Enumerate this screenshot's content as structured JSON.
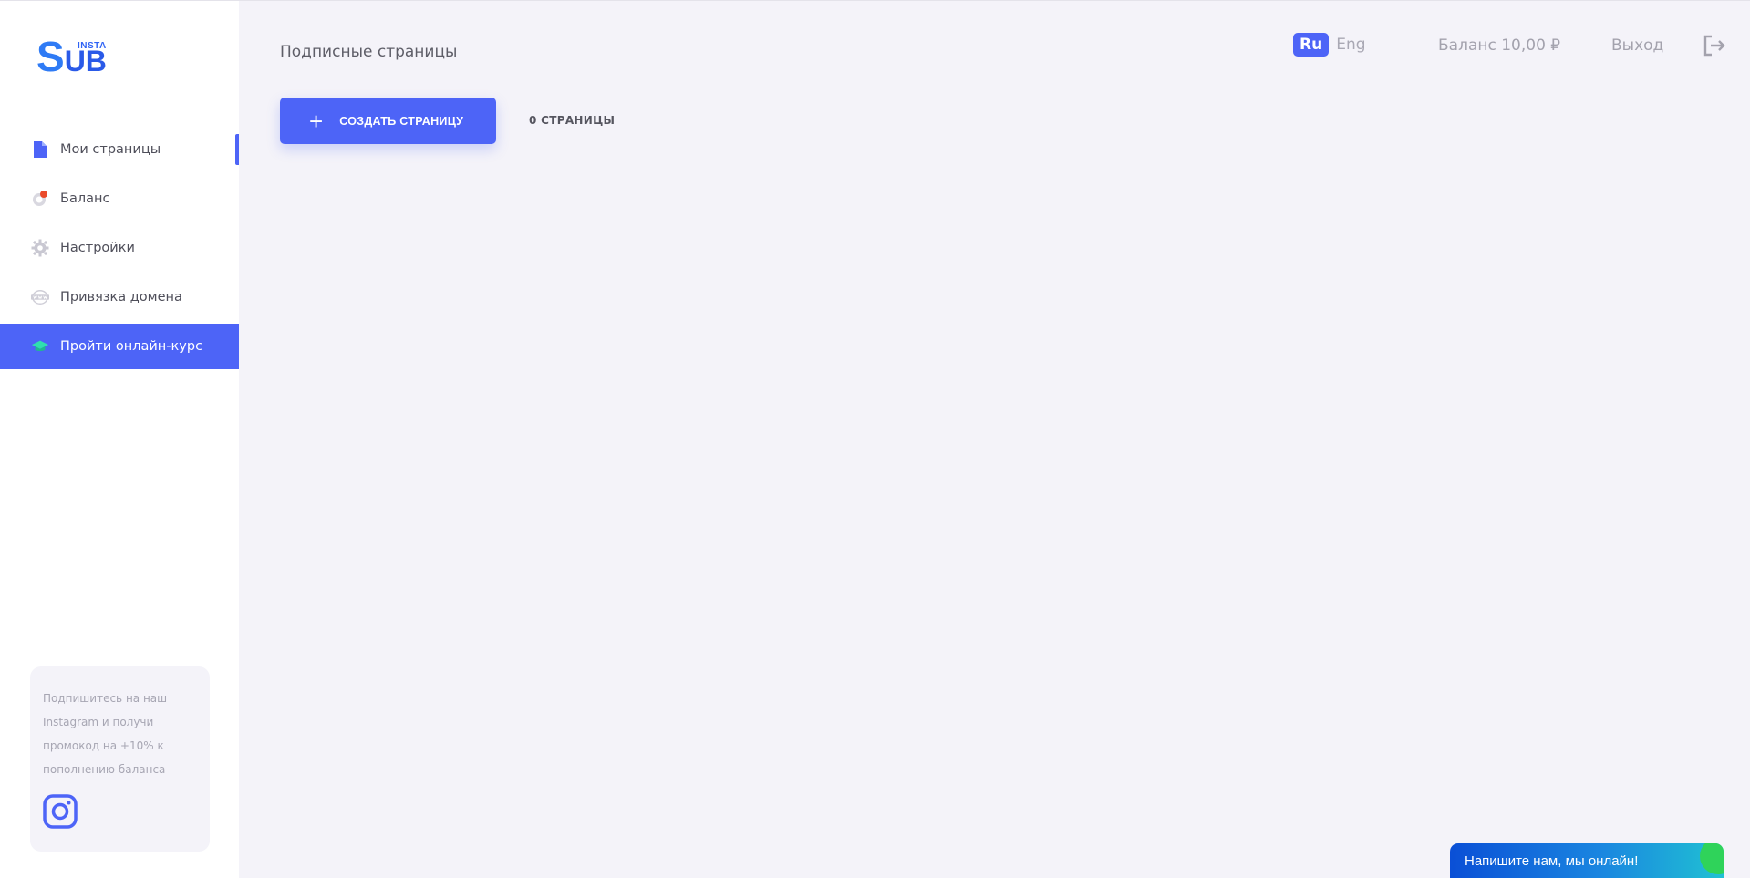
{
  "logo": {
    "small": "INSTA",
    "big_s": "S",
    "big_rest": "UB"
  },
  "sidebar": {
    "items": [
      {
        "label": "Мои страницы",
        "icon": "document-icon"
      },
      {
        "label": "Баланс",
        "icon": "coin-icon"
      },
      {
        "label": "Настройки",
        "icon": "gear-icon"
      },
      {
        "label": "Привязка домена",
        "icon": "www-globe-icon"
      },
      {
        "label": "Пройти онлайн-курс",
        "icon": "graduation-cap-icon"
      }
    ],
    "promo_text": "Подпишитесь на наш Instagram и получи промокод на +10% к пополнению баланса"
  },
  "header": {
    "title": "Подписные страницы",
    "lang_ru": "Ru",
    "lang_en": "Eng",
    "balance": "Баланс 10,00 ₽",
    "logout": "Выход"
  },
  "toolbar": {
    "create_plus": "+",
    "create_label": "СОЗДАТЬ СТРАНИЦУ",
    "count": "0 СТРАНИЦЫ"
  },
  "chat": {
    "label": "Напишите нам, мы онлайн!"
  },
  "colors": {
    "accent": "#4d64f7",
    "background": "#f4f3f9",
    "chat_start": "#0a4fd6",
    "chat_end": "#20c1d3",
    "online": "#2fd35a"
  }
}
